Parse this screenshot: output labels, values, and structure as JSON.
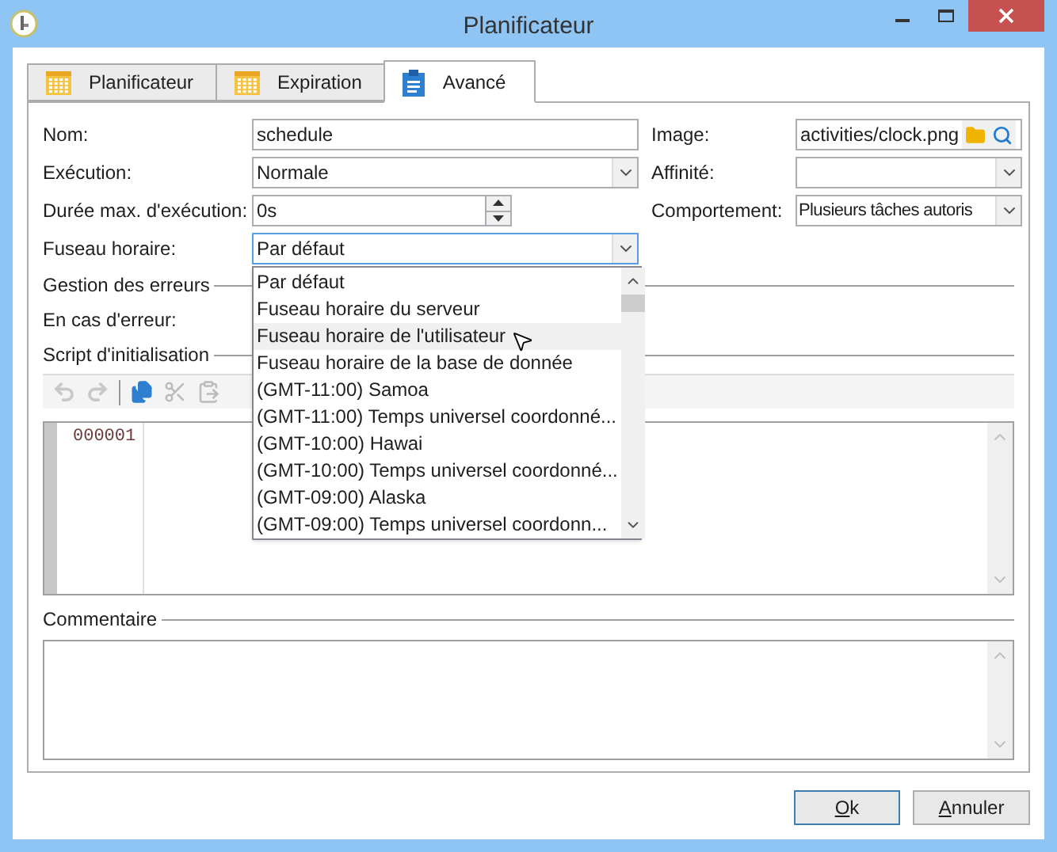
{
  "window": {
    "title": "Planificateur"
  },
  "tabs": [
    {
      "label": "Planificateur",
      "selected": false,
      "kind": "calendar"
    },
    {
      "label": "Expiration",
      "selected": false,
      "kind": "calendar"
    },
    {
      "label": "Avancé",
      "selected": true,
      "kind": "clipboard"
    }
  ],
  "form": {
    "name": {
      "label": "Nom:",
      "value": "schedule"
    },
    "execution": {
      "label": "Exécution:",
      "value": "Normale"
    },
    "max_duration": {
      "label": "Durée max. d'exécution:",
      "value": "0s"
    },
    "timezone": {
      "label": "Fuseau horaire:",
      "value": "Par défaut",
      "expanded": true,
      "options": [
        {
          "label": "Par défaut",
          "highlighted": false
        },
        {
          "label": "Fuseau horaire du serveur",
          "highlighted": false
        },
        {
          "label": "Fuseau horaire de l'utilisateur",
          "highlighted": true
        },
        {
          "label": "Fuseau horaire de la base de donnée",
          "highlighted": false
        },
        {
          "label": "(GMT-11:00) Samoa",
          "highlighted": false
        },
        {
          "label": "(GMT-11:00) Temps universel coordonné...",
          "highlighted": false
        },
        {
          "label": "(GMT-10:00) Hawai",
          "highlighted": false
        },
        {
          "label": "(GMT-10:00) Temps universel coordonné...",
          "highlighted": false
        },
        {
          "label": "(GMT-09:00) Alaska",
          "highlighted": false
        },
        {
          "label": "(GMT-09:00) Temps universel coordonn...",
          "highlighted": false
        }
      ]
    },
    "image": {
      "label": "Image:",
      "value": "activities/clock.png"
    },
    "affinity": {
      "label": "Affinité:"
    },
    "behaviour": {
      "label": "Comportement:",
      "value": "Plusieurs tâches autoris"
    }
  },
  "error_section": {
    "title": "Gestion des erreurs",
    "on_error_label": "En cas d'erreur:"
  },
  "script_section": {
    "title": "Script d'initialisation",
    "line_numbers": [
      "000001"
    ]
  },
  "comment_section": {
    "title": "Commentaire"
  },
  "buttons": [
    {
      "label": "Ok",
      "default": true
    },
    {
      "label": "Annuler",
      "default": false
    }
  ]
}
